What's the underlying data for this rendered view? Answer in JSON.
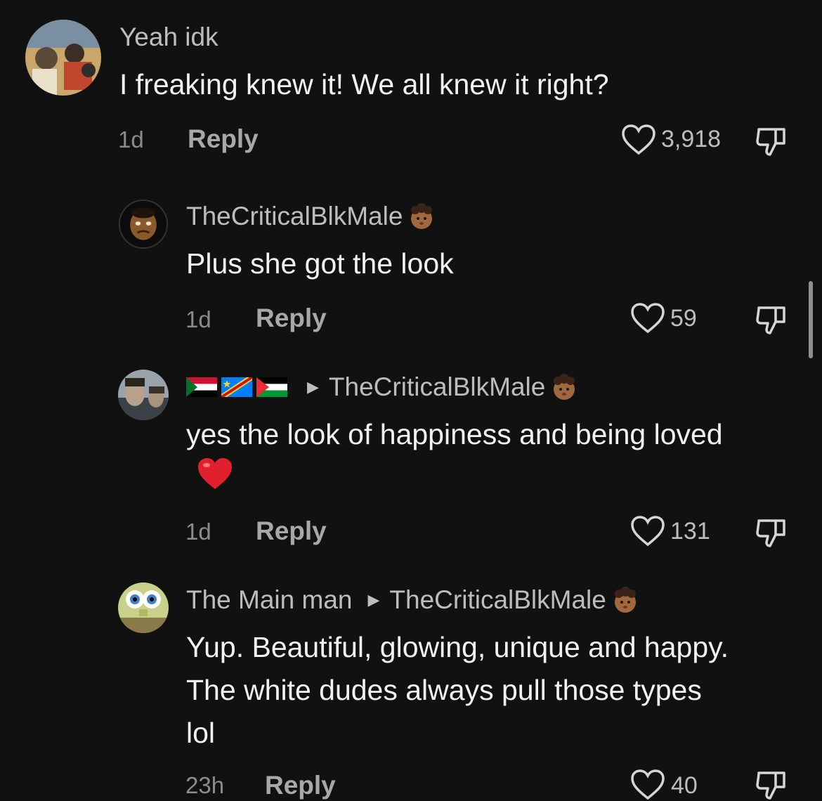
{
  "comments": [
    {
      "author": "Yeah idk",
      "text": "I freaking knew it! We all knew it right?",
      "time": "1d",
      "reply_label": "Reply",
      "likes": "3,918"
    },
    {
      "author": "TheCriticalBlkMale",
      "text": "Plus she got the look",
      "time": "1d",
      "reply_label": "Reply",
      "likes": "59"
    },
    {
      "author_flags": [
        "flag-sudan",
        "flag-drc",
        "flag-palestine"
      ],
      "replying_to": "TheCriticalBlkMale",
      "text": "yes the look of happiness and being loved",
      "time": "1d",
      "reply_label": "Reply",
      "likes": "131"
    },
    {
      "author": "The Main man",
      "replying_to": "TheCriticalBlkMale",
      "text": "Yup. Beautiful, glowing, unique and happy. The white dudes always pull those types lol",
      "time": "23h",
      "reply_label": "Reply",
      "likes": "40"
    }
  ],
  "icons": {
    "like": "heart-outline-icon",
    "dislike": "thumbs-down-icon",
    "reply_arrow": "triangle-right-icon",
    "verified_emoji": "man-curly-hair-emoji",
    "heart": "red-heart-emoji"
  },
  "colors": {
    "background": "#111111",
    "text": "#f2f2f2",
    "muted": "#8c8c8c",
    "heart": "#e0202c"
  }
}
